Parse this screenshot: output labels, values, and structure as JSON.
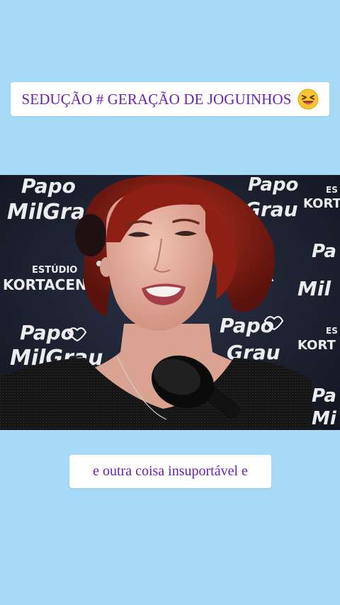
{
  "top_caption": {
    "text": "SEDUÇÃO # GERAÇÃO DE JOGUINHOS",
    "emoji": "grinning-squinting-face-emoji"
  },
  "bottom_caption": {
    "text": "e outra coisa insuportável e"
  },
  "video_frame": {
    "backdrop_brand_a": [
      "Papo",
      "MilGrau"
    ],
    "backdrop_brand_b": [
      "ESTÚDIO",
      "KORTACENA"
    ]
  },
  "colors": {
    "background": "#a6daf6",
    "caption_text": "#6a1fb5",
    "caption_bg": "#ffffff"
  }
}
